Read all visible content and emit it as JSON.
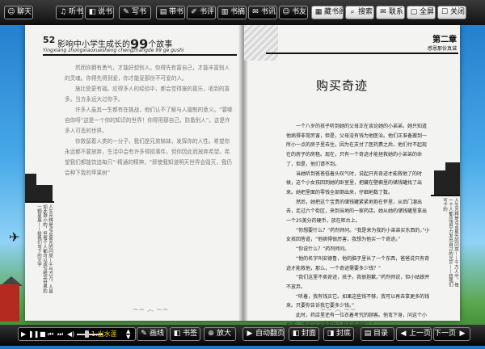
{
  "toolbar": {
    "buttons": [
      {
        "id": "chat",
        "icon": "☺",
        "label": "聊天"
      },
      {
        "id": "music",
        "icon": "♫",
        "label": "听书"
      },
      {
        "id": "read",
        "icon": "◧",
        "label": "说书"
      },
      {
        "id": "write",
        "icon": "✎",
        "label": "写书"
      },
      {
        "id": "bring",
        "icon": "▤",
        "label": "带书"
      },
      {
        "id": "review",
        "icon": "✐",
        "label": "书评"
      },
      {
        "id": "excerpt",
        "icon": "▥",
        "label": "书摘"
      },
      {
        "id": "news",
        "icon": "✉",
        "label": "书讯"
      },
      {
        "id": "friends",
        "icon": "☺",
        "label": "书友"
      },
      {
        "id": "collection",
        "icon": "▦",
        "label": "藏书阁"
      },
      {
        "id": "search",
        "icon": "⌕",
        "label": "搜索"
      },
      {
        "id": "contact",
        "icon": "✉",
        "label": "联系"
      },
      {
        "id": "fullscreen",
        "icon": "▢",
        "label": "全屏"
      },
      {
        "id": "close",
        "icon": "☐",
        "label": "关闭"
      }
    ]
  },
  "book": {
    "left": {
      "page_number": "52",
      "title_prefix": "影响中小学生成长的",
      "title_num": "99",
      "title_suffix": "个故事",
      "subtitle_italic": "Yingxiang zhongxiaoxuesheng chengzhangde 99 ge gushi",
      "paragraphs": [
        "然而你拥有勇气，才能好想别人。你得先有富自己，才能丰富别人的灵魂。你得先得到爱，你才能爱那份不可爱的人。",
        "施比受更有福。应得多人的经验中，都会觉得施的喜乐，收到的喜多。当方永远大过你予。",
        "许多人虽其一生都有在挑战，他们认不了解与人援制的意义。“要哪自你呀”这是一个你的知识的世界！你得用那自己，防备别人”。这是许多人可悲的世界。",
        "你救留着人类的一分子，我们是兄弟姊妹，发挥你的人性。希望你永远都不要放弃，生活中会有许多得损事件，但你因此而放弃希望。希望我们都能饮追每只“-精通的精神，“即使我知道明天世界会毁灭，我仍会种下我的苹果树”"
      ],
      "vertical_text": "人生光辉是点点星光的闪亮—千与万万，人是如此渺小的，但每个人都可以成为照亮世界的一颗星辰——给我们写下的文字"
    },
    "right": {
      "chapter": "第二章",
      "chapter_sub": "感恩那份真诚",
      "title": "购买奇迹",
      "paragraphs": [
        "一个八岁的孩子听到她的父母正在谈论她的小弟弟，她只知道他病得非常厉害，但是，父母没有钱为他医治。他们正准备搬到一所小一点的房子里去住，因为在支付了医药费之后，他们付不起现在的房子的房租。现在，只有一个奇迹才能拯救她的小弟弟的命了，但是，他们请不到。",
        "当她听到爸爸低着头叹气时，说起只有奇迹才能救他了的时候，这个小女孩回到她的卧室里，把藏在壁橱里的储钱罐找了出来。她把里面的零钱全部倒出来，仔细地数了数。",
        "然后，她把这个宝贵的储钱罐紧紧地抱在怀里，从后门溜出去，走过六个街区，来到当地的一家药店。她从她的储钱罐里拿出一个25美分的硬币，放在柜台上。",
        "“你想要什么？”药剂师问。“我是来为我的小弟弟买东西的，”小女孩回答道，“他病得很厉害，我想为他买一个奇迹。”",
        "“你说什么？”药剂师问。",
        "“他的名字叫安德鲁，他的脑子里长了一个东西，爸爸说只有奇迹才能救他，那么，一个奇迹需要多少钱？”",
        "“我们这里不卖奇迹，孩子。我很抱歉。”药剂师说，但小姑娘并不放弃。",
        "“听着，我有钱买它。如果这些钱不够，我可以再去拿更多的钱来。只要你告诉我它要多少钱。”",
        "此时，药店里还有一位衣着考究的顾客。他弯下身，问这个小女孩：“你的弟弟需要什么样的奇迹呢？”",
        "“我不知道，”她抬起泪眼看着那位顾客说道，“他病得很重，妈妈说他需要"
      ],
      "vertical_text": "人生光辉是点点星光的闪亮——千万人中，每一个人都应该尽力发出自己的光芒——给我们写下的"
    }
  },
  "bottombar": {
    "track": "1.出水莲",
    "buttons": [
      {
        "id": "pen",
        "icon": "✎",
        "label": "画线"
      },
      {
        "id": "bookmark",
        "icon": "◧",
        "label": "书签"
      },
      {
        "id": "zoom",
        "icon": "⊕",
        "label": "放大"
      },
      {
        "id": "autoflip",
        "icon": "▶",
        "label": "自动翻页"
      },
      {
        "id": "cover",
        "icon": "◧",
        "label": "封面"
      },
      {
        "id": "backcover",
        "icon": "◨",
        "label": "封底"
      },
      {
        "id": "toc",
        "icon": "▤",
        "label": "目录"
      },
      {
        "id": "prev",
        "icon": "◀",
        "label": "上一页"
      },
      {
        "id": "next",
        "icon": "▶",
        "label": "下一页"
      }
    ]
  }
}
